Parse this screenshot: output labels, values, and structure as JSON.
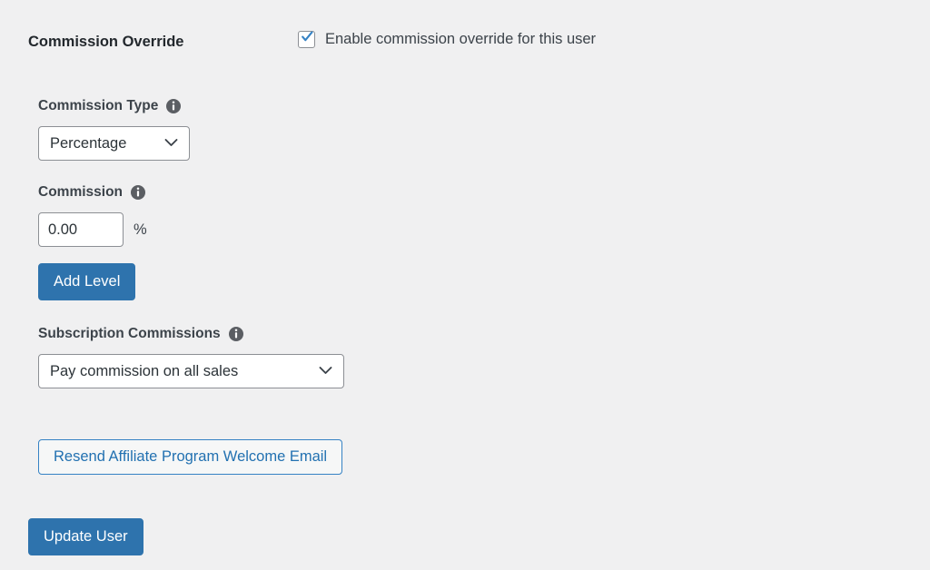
{
  "section": {
    "title": "Commission Override",
    "enable_checkbox": {
      "label": "Enable commission override for this user",
      "checked": true,
      "icon": "checkmark-icon"
    }
  },
  "fields": {
    "commission_type": {
      "label": "Commission Type",
      "info_icon": "info-icon",
      "value": "Percentage",
      "chevron_icon": "chevron-down-icon",
      "options": [
        "Percentage"
      ]
    },
    "commission": {
      "label": "Commission",
      "info_icon": "info-icon",
      "value": "0.00",
      "placeholder": "0.00",
      "unit": "%"
    },
    "add_level": {
      "label": "Add Level"
    },
    "subscription_commissions": {
      "label": "Subscription Commissions",
      "info_icon": "info-icon",
      "value": "Pay commission on all sales",
      "chevron_icon": "chevron-down-icon",
      "options": [
        "Pay commission on all sales"
      ]
    }
  },
  "actions": {
    "resend_email": "Resend Affiliate Program Welcome Email",
    "update_user": "Update User"
  },
  "colors": {
    "background": "#f0f0f1",
    "primary_button": "#2e73ad",
    "link_blue": "#2271b1",
    "border_gray": "#8c8f94",
    "text_dark": "#3c434a",
    "checkbox_check": "#3582c4",
    "info_icon_fill": "#5b5e63"
  }
}
